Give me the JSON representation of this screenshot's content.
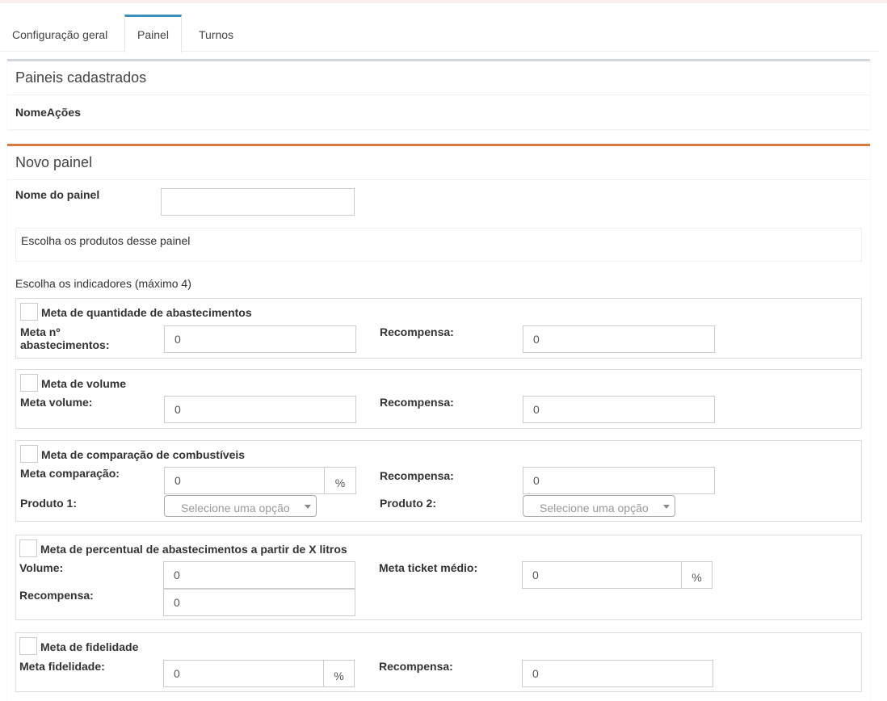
{
  "tabs": [
    {
      "label": "Configuração geral"
    },
    {
      "label": "Painel"
    },
    {
      "label": "Turnos"
    }
  ],
  "registered": {
    "title": "Paineis cadastrados",
    "col_name": "Nome",
    "col_actions": "Ações"
  },
  "new_panel": {
    "title": "Novo painel",
    "name_label": "Nome do painel",
    "name_value": "",
    "products_label": "Escolha os produtos desse painel",
    "indicators_label": "Escolha os indicadores (máximo 4)"
  },
  "indicators": {
    "quantity": {
      "title": "Meta de quantidade de abastecimentos",
      "goal_label": "Meta nº abastecimentos:",
      "goal_value": "0",
      "reward_label": "Recompensa:",
      "reward_value": "0"
    },
    "volume": {
      "title": "Meta de volume",
      "goal_label": "Meta volume:",
      "goal_value": "0",
      "reward_label": "Recompensa:",
      "reward_value": "0"
    },
    "comparison": {
      "title": "Meta de comparação de combustíveis",
      "goal_label": "Meta comparação:",
      "goal_value": "0",
      "goal_unit": "%",
      "reward_label": "Recompensa:",
      "reward_value": "0",
      "product1_label": "Produto 1:",
      "product2_label": "Produto 2:",
      "select_placeholder": "Selecione uma opção"
    },
    "percentage": {
      "title": "Meta de percentual de abastecimentos a partir de X litros",
      "volume_label": "Volume:",
      "volume_value": "0",
      "ticket_label": "Meta ticket médio:",
      "ticket_value": "0",
      "ticket_unit": "%",
      "reward_label": "Recompensa:",
      "reward_value": "0"
    },
    "loyalty": {
      "title": "Meta de fidelidade",
      "goal_label": "Meta fidelidade:",
      "goal_value": "0",
      "goal_unit": "%",
      "reward_label": "Recompensa:",
      "reward_value": "0"
    }
  }
}
